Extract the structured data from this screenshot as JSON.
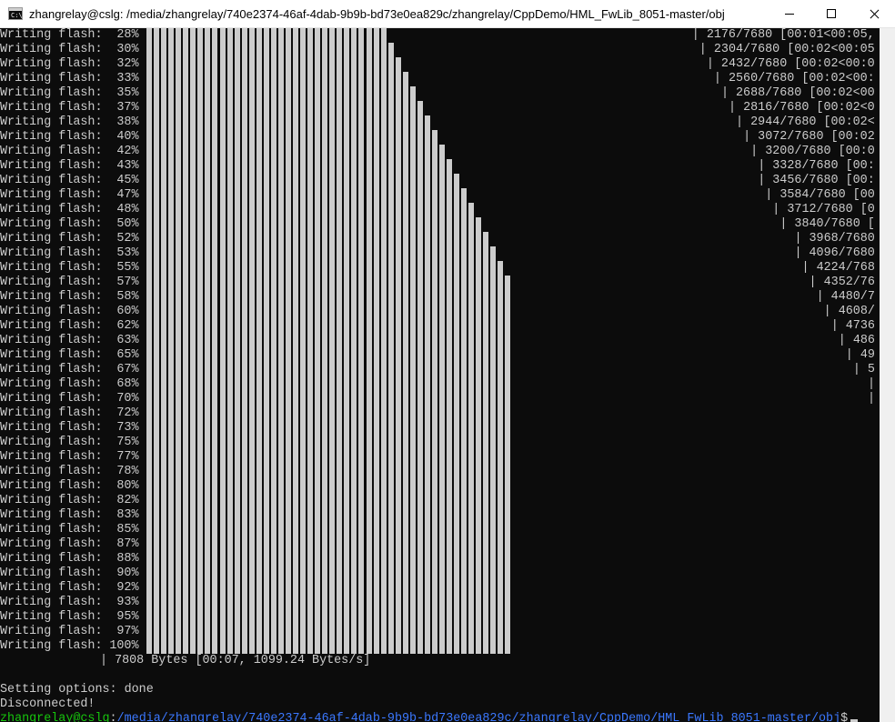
{
  "window": {
    "title": "zhangrelay@cslg: /media/zhangrelay/740e2374-46af-4dab-9b9b-bd73e0ea829c/zhangrelay/CppDemo/HML_FwLib_8051-master/obj",
    "app_icon_label": "C:\\",
    "controls": {
      "minimize": "minimize",
      "maximize": "maximize",
      "close": "close"
    }
  },
  "terminal": {
    "progress_label": "Writing flash:",
    "progress_lines": [
      {
        "percent": "28%",
        "tail": "| 2176/7680 [00:01<00:05,"
      },
      {
        "percent": "30%",
        "tail": "| 2304/7680 [00:02<00:05"
      },
      {
        "percent": "32%",
        "tail": "| 2432/7680 [00:02<00:0"
      },
      {
        "percent": "33%",
        "tail": "| 2560/7680 [00:02<00:"
      },
      {
        "percent": "35%",
        "tail": "| 2688/7680 [00:02<00"
      },
      {
        "percent": "37%",
        "tail": "| 2816/7680 [00:02<0"
      },
      {
        "percent": "38%",
        "tail": "| 2944/7680 [00:02<"
      },
      {
        "percent": "40%",
        "tail": "| 3072/7680 [00:02"
      },
      {
        "percent": "42%",
        "tail": "| 3200/7680 [00:0"
      },
      {
        "percent": "43%",
        "tail": "| 3328/7680 [00:"
      },
      {
        "percent": "45%",
        "tail": "| 3456/7680 [00:"
      },
      {
        "percent": "47%",
        "tail": "| 3584/7680 [00"
      },
      {
        "percent": "48%",
        "tail": "| 3712/7680 [0"
      },
      {
        "percent": "50%",
        "tail": "| 3840/7680 ["
      },
      {
        "percent": "52%",
        "tail": "| 3968/7680"
      },
      {
        "percent": "53%",
        "tail": "| 4096/7680"
      },
      {
        "percent": "55%",
        "tail": "| 4224/768"
      },
      {
        "percent": "57%",
        "tail": "| 4352/76"
      },
      {
        "percent": "58%",
        "tail": "| 4480/7"
      },
      {
        "percent": "60%",
        "tail": "| 4608/"
      },
      {
        "percent": "62%",
        "tail": "| 4736"
      },
      {
        "percent": "63%",
        "tail": "| 486"
      },
      {
        "percent": "65%",
        "tail": "| 49"
      },
      {
        "percent": "67%",
        "tail": "| 5"
      },
      {
        "percent": "68%",
        "tail": "|"
      },
      {
        "percent": "70%",
        "tail": "|"
      },
      {
        "percent": "72%",
        "tail": ""
      },
      {
        "percent": "73%",
        "tail": ""
      },
      {
        "percent": "75%",
        "tail": ""
      },
      {
        "percent": "77%",
        "tail": ""
      },
      {
        "percent": "78%",
        "tail": ""
      },
      {
        "percent": "80%",
        "tail": ""
      },
      {
        "percent": "82%",
        "tail": ""
      },
      {
        "percent": "83%",
        "tail": ""
      },
      {
        "percent": "85%",
        "tail": ""
      },
      {
        "percent": "87%",
        "tail": ""
      },
      {
        "percent": "88%",
        "tail": ""
      },
      {
        "percent": "90%",
        "tail": ""
      },
      {
        "percent": "92%",
        "tail": ""
      },
      {
        "percent": "93%",
        "tail": ""
      },
      {
        "percent": "95%",
        "tail": ""
      },
      {
        "percent": "97%",
        "tail": ""
      },
      {
        "percent": "100%",
        "tail": "| 7808 Bytes [00:07, 1099.24 Bytes/s]"
      }
    ],
    "setting_options": "Setting options: done",
    "disconnected": "Disconnected!",
    "prompt": {
      "user_host": "zhangrelay@cslg",
      "separator": ":",
      "path": "/media/zhangrelay/740e2374-46af-4dab-9b9b-bd73e0ea829c/zhangrelay/CppDemo/HML_FwLib_8051-master/obj",
      "symbol": "$"
    }
  },
  "colors": {
    "background": "#0c0c0c",
    "foreground": "#cccccc",
    "prompt_user": "#16c60c",
    "prompt_path": "#3b78ff"
  }
}
